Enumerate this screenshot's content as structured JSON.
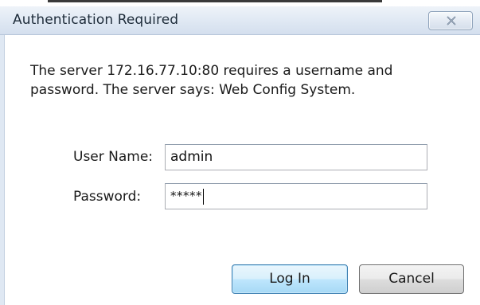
{
  "dialog": {
    "title": "Authentication Required",
    "close_icon": "close-x-icon",
    "message": "The server 172.16.77.10:80 requires a username and password. The server says: Web Config System.",
    "username_label": "User Name:",
    "username_value": "admin",
    "password_label": "Password:",
    "password_value": "*****",
    "login_label": "Log In",
    "cancel_label": "Cancel"
  }
}
